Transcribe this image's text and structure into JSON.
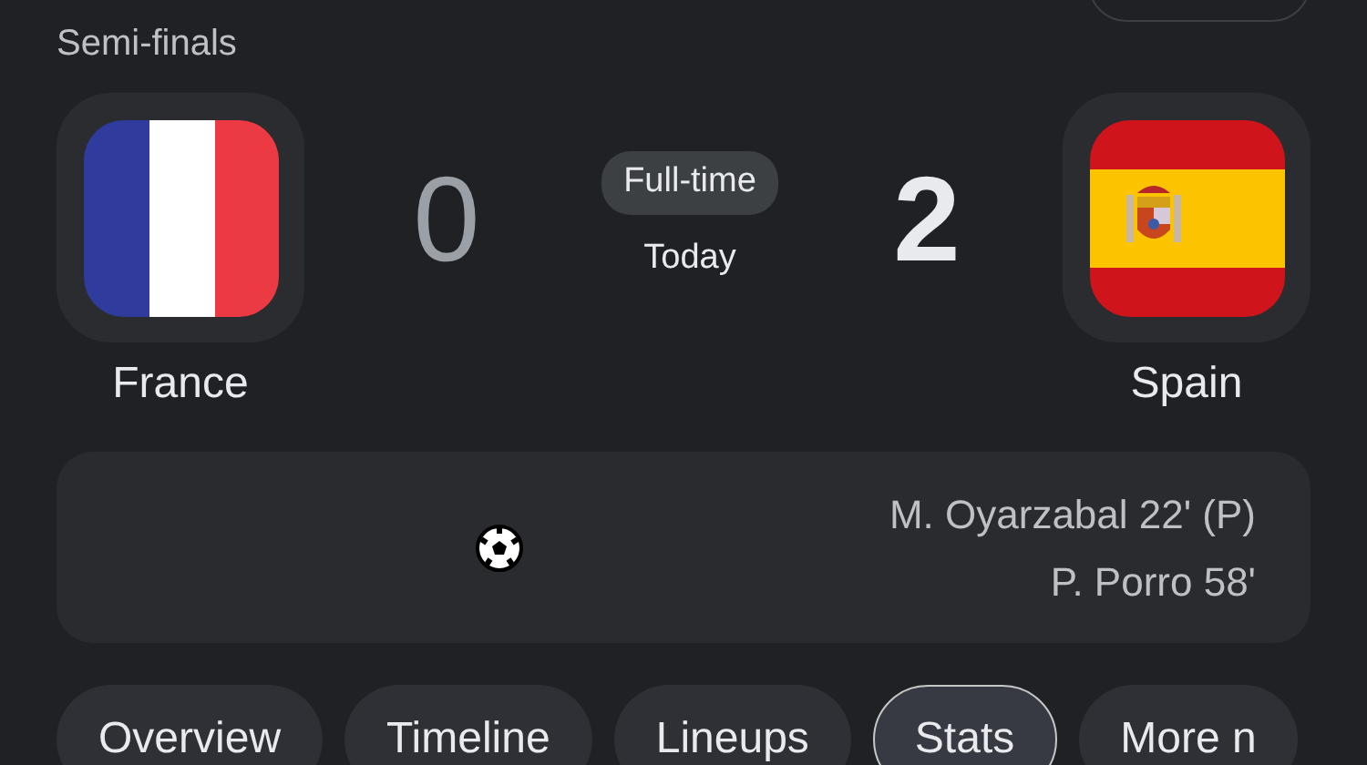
{
  "stage": "Semi-finals",
  "home": {
    "name": "France",
    "score": "0",
    "winner": false,
    "kind": "tricolor"
  },
  "away": {
    "name": "Spain",
    "score": "2",
    "winner": true,
    "kind": "spain"
  },
  "status": {
    "badge": "Full-time",
    "date": "Today"
  },
  "scorers": [
    "M. Oyarzabal 22' (P)",
    "P. Porro 58'"
  ],
  "tabs": [
    {
      "label": "Overview",
      "selected": false
    },
    {
      "label": "Timeline",
      "selected": false
    },
    {
      "label": "Lineups",
      "selected": false
    },
    {
      "label": "Stats",
      "selected": true
    },
    {
      "label": "More n",
      "selected": false
    }
  ]
}
